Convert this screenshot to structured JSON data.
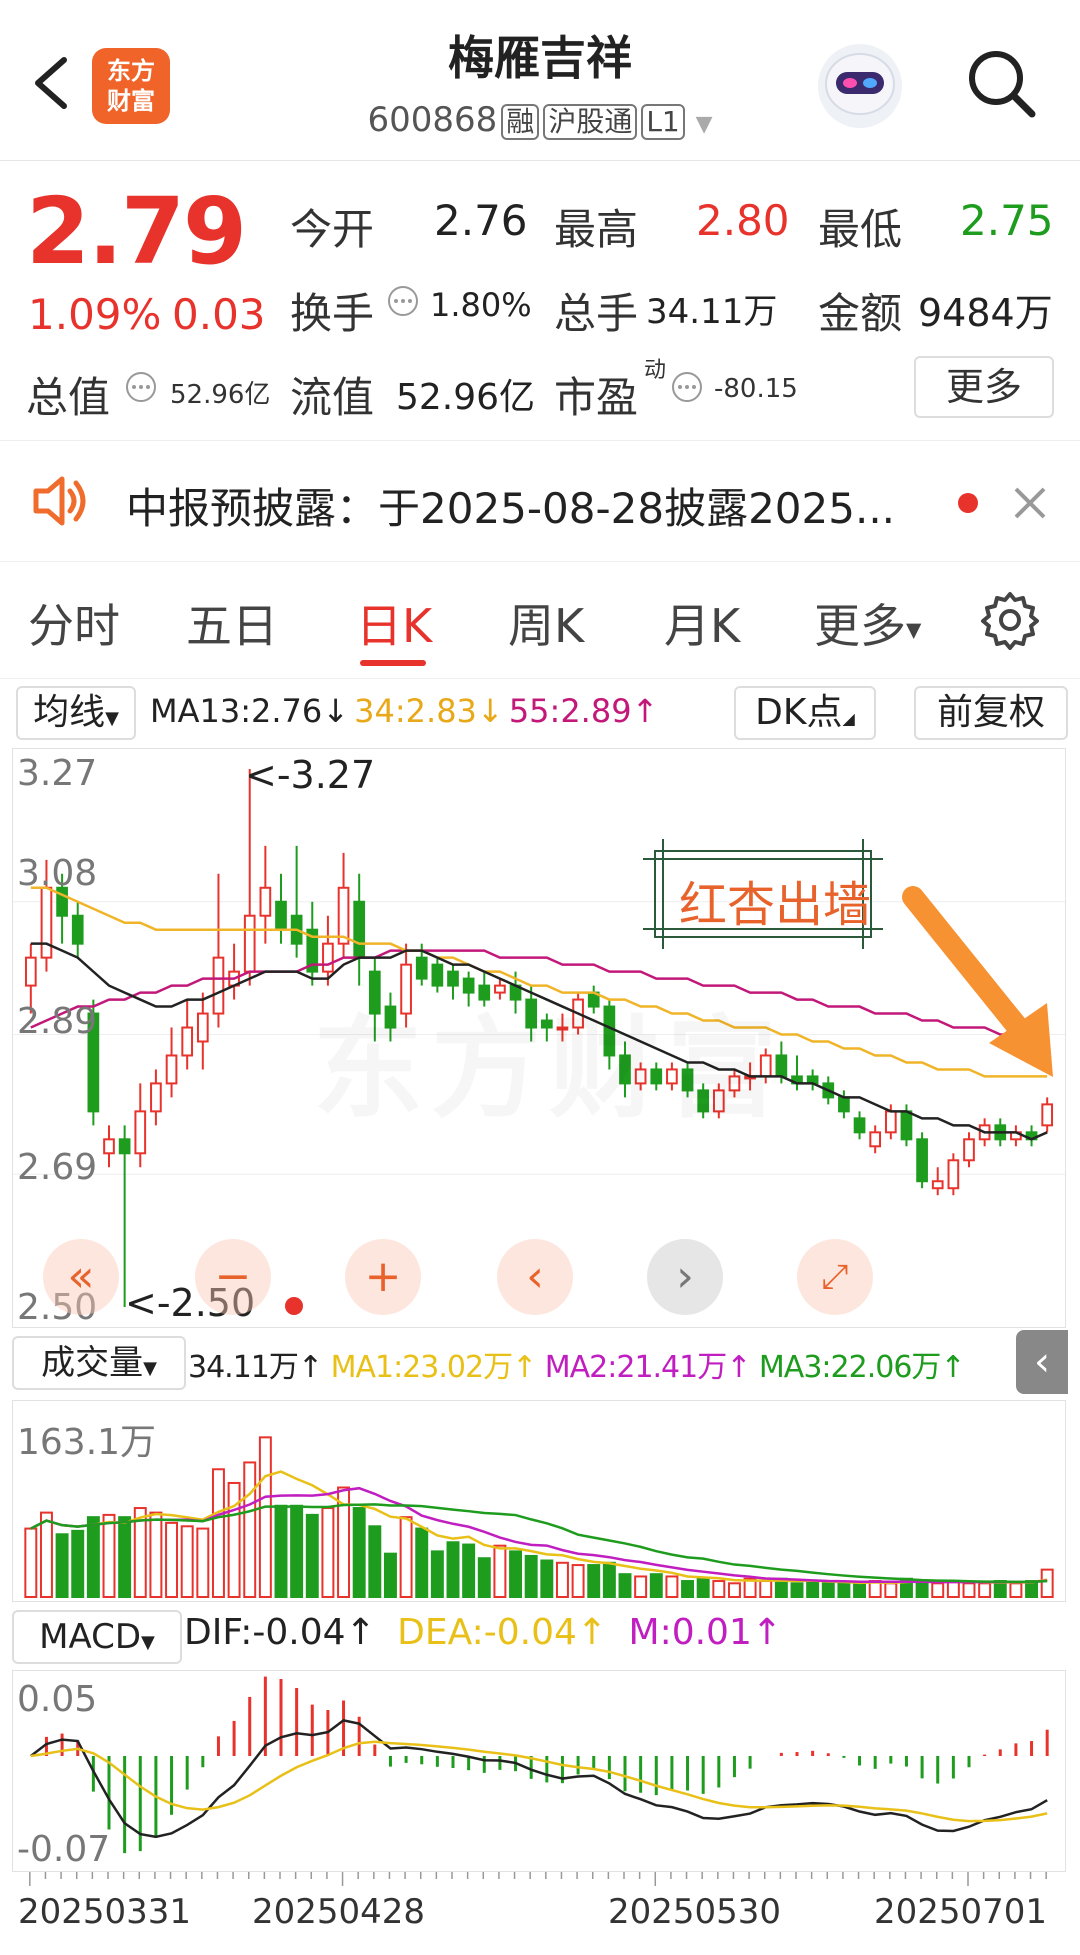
{
  "header": {
    "back_label": "<",
    "logo_text_line1": "东方",
    "logo_text_line2": "财富",
    "stock_name": "梅雁吉祥",
    "stock_code": "600868",
    "tags": [
      "融",
      "沪股通",
      "L1"
    ]
  },
  "quote": {
    "price": "2.79",
    "change_pct": "1.09%",
    "change_abs": "0.03",
    "open_label": "今开",
    "open": "2.76",
    "high_label": "最高",
    "high": "2.80",
    "low_label": "最低",
    "low": "2.75",
    "turnover_label": "换手",
    "turnover": "1.80%",
    "volume_label": "总手",
    "volume": "34.11万",
    "amount_label": "金额",
    "amount": "9484万",
    "total_cap_label": "总值",
    "total_cap": "52.96亿",
    "float_cap_label": "流值",
    "float_cap": "52.96亿",
    "pe_label": "市盈",
    "pe_sup": "动",
    "pe": "-80.15",
    "more_label": "更多"
  },
  "notice": {
    "text": "中报预披露：于2025-08-28披露2025..."
  },
  "tabs": [
    {
      "label": "分时"
    },
    {
      "label": "五日"
    },
    {
      "label": "日K"
    },
    {
      "label": "周K"
    },
    {
      "label": "月K"
    },
    {
      "label": "更多"
    }
  ],
  "kchart": {
    "ma_select": "均线",
    "ma13": "MA13:2.76↓",
    "ma34": "34:2.83↓",
    "ma55": "55:2.89↑",
    "dk_label": "DK点",
    "fq_label": "前复权",
    "y_labels": [
      "3.27",
      "3.08",
      "2.89",
      "2.69",
      "2.50"
    ],
    "max_marker": "<-3.27",
    "min_marker": "<-2.50",
    "annotation": "红杏出墙",
    "watermark": "东方财富",
    "colors": {
      "up": "#e8322c",
      "down": "#1e9c1e",
      "ma13": "#222222",
      "ma34": "#f0b429",
      "ma55": "#c2187a",
      "arrow": "#f79232"
    }
  },
  "volume": {
    "select": "成交量",
    "value": "34.11万↑",
    "ma1": "MA1:23.02万↑",
    "ma2": "MA2:21.41万↑",
    "ma3": "MA3:22.06万↑",
    "max_label": "163.1万"
  },
  "macd": {
    "select": "MACD",
    "dif": "DIF:-0.04↑",
    "dea": "DEA:-0.04↑",
    "m": "M:0.01↑",
    "top_label": "0.05",
    "bottom_label": "-0.07"
  },
  "dates": [
    "20250331",
    "20250428",
    "20250530",
    "20250701"
  ],
  "chart_data": {
    "type": "candlestick",
    "candles": [
      {
        "o": 2.96,
        "c": 3.0,
        "h": 3.02,
        "l": 2.92
      },
      {
        "o": 3.0,
        "c": 3.1,
        "h": 3.14,
        "l": 2.98
      },
      {
        "o": 3.1,
        "c": 3.06,
        "h": 3.12,
        "l": 3.02
      },
      {
        "o": 3.06,
        "c": 3.02,
        "h": 3.08,
        "l": 3.0
      },
      {
        "o": 2.92,
        "c": 2.78,
        "h": 2.94,
        "l": 2.76
      },
      {
        "o": 2.72,
        "c": 2.74,
        "h": 2.76,
        "l": 2.7
      },
      {
        "o": 2.74,
        "c": 2.72,
        "h": 2.76,
        "l": 2.5
      },
      {
        "o": 2.72,
        "c": 2.78,
        "h": 2.82,
        "l": 2.7
      },
      {
        "o": 2.78,
        "c": 2.82,
        "h": 2.84,
        "l": 2.76
      },
      {
        "o": 2.82,
        "c": 2.86,
        "h": 2.9,
        "l": 2.8
      },
      {
        "o": 2.86,
        "c": 2.9,
        "h": 2.94,
        "l": 2.84
      },
      {
        "o": 2.88,
        "c": 2.92,
        "h": 2.95,
        "l": 2.84
      },
      {
        "o": 2.92,
        "c": 3.0,
        "h": 3.12,
        "l": 2.9
      },
      {
        "o": 2.96,
        "c": 2.98,
        "h": 3.02,
        "l": 2.94
      },
      {
        "o": 2.98,
        "c": 3.06,
        "h": 3.27,
        "l": 2.96
      },
      {
        "o": 3.06,
        "c": 3.1,
        "h": 3.16,
        "l": 3.02
      },
      {
        "o": 3.08,
        "c": 3.04,
        "h": 3.12,
        "l": 3.02
      },
      {
        "o": 3.06,
        "c": 3.02,
        "h": 3.16,
        "l": 3.0
      },
      {
        "o": 3.04,
        "c": 2.98,
        "h": 3.08,
        "l": 2.96
      },
      {
        "o": 2.98,
        "c": 3.02,
        "h": 3.06,
        "l": 2.96
      },
      {
        "o": 3.02,
        "c": 3.1,
        "h": 3.15,
        "l": 3.0
      },
      {
        "o": 3.08,
        "c": 3.0,
        "h": 3.12,
        "l": 2.96
      },
      {
        "o": 2.98,
        "c": 2.92,
        "h": 3.0,
        "l": 2.88
      },
      {
        "o": 2.93,
        "c": 2.9,
        "h": 2.95,
        "l": 2.88
      },
      {
        "o": 2.92,
        "c": 2.99,
        "h": 3.02,
        "l": 2.9
      },
      {
        "o": 3.0,
        "c": 2.97,
        "h": 3.02,
        "l": 2.96
      },
      {
        "o": 2.99,
        "c": 2.96,
        "h": 3.0,
        "l": 2.95
      },
      {
        "o": 2.98,
        "c": 2.96,
        "h": 2.99,
        "l": 2.94
      },
      {
        "o": 2.97,
        "c": 2.95,
        "h": 2.98,
        "l": 2.93
      },
      {
        "o": 2.96,
        "c": 2.94,
        "h": 2.98,
        "l": 2.93
      },
      {
        "o": 2.95,
        "c": 2.96,
        "h": 2.97,
        "l": 2.94
      },
      {
        "o": 2.96,
        "c": 2.94,
        "h": 2.98,
        "l": 2.92
      },
      {
        "o": 2.94,
        "c": 2.9,
        "h": 2.96,
        "l": 2.88
      },
      {
        "o": 2.91,
        "c": 2.9,
        "h": 2.92,
        "l": 2.88
      },
      {
        "o": 2.9,
        "c": 2.9,
        "h": 2.92,
        "l": 2.88
      },
      {
        "o": 2.9,
        "c": 2.94,
        "h": 2.95,
        "l": 2.89
      },
      {
        "o": 2.95,
        "c": 2.93,
        "h": 2.96,
        "l": 2.92
      },
      {
        "o": 2.93,
        "c": 2.86,
        "h": 2.94,
        "l": 2.84
      },
      {
        "o": 2.86,
        "c": 2.82,
        "h": 2.88,
        "l": 2.8
      },
      {
        "o": 2.82,
        "c": 2.84,
        "h": 2.85,
        "l": 2.81
      },
      {
        "o": 2.84,
        "c": 2.82,
        "h": 2.85,
        "l": 2.81
      },
      {
        "o": 2.82,
        "c": 2.84,
        "h": 2.85,
        "l": 2.81
      },
      {
        "o": 2.84,
        "c": 2.81,
        "h": 2.85,
        "l": 2.8
      },
      {
        "o": 2.81,
        "c": 2.78,
        "h": 2.82,
        "l": 2.77
      },
      {
        "o": 2.78,
        "c": 2.81,
        "h": 2.82,
        "l": 2.77
      },
      {
        "o": 2.81,
        "c": 2.83,
        "h": 2.84,
        "l": 2.8
      },
      {
        "o": 2.83,
        "c": 2.83,
        "h": 2.85,
        "l": 2.81
      },
      {
        "o": 2.83,
        "c": 2.86,
        "h": 2.87,
        "l": 2.82
      },
      {
        "o": 2.86,
        "c": 2.83,
        "h": 2.88,
        "l": 2.82
      },
      {
        "o": 2.83,
        "c": 2.82,
        "h": 2.86,
        "l": 2.81
      },
      {
        "o": 2.83,
        "c": 2.82,
        "h": 2.84,
        "l": 2.81
      },
      {
        "o": 2.82,
        "c": 2.8,
        "h": 2.83,
        "l": 2.79
      },
      {
        "o": 2.8,
        "c": 2.78,
        "h": 2.81,
        "l": 2.77
      },
      {
        "o": 2.77,
        "c": 2.75,
        "h": 2.78,
        "l": 2.74
      },
      {
        "o": 2.73,
        "c": 2.75,
        "h": 2.76,
        "l": 2.72
      },
      {
        "o": 2.75,
        "c": 2.78,
        "h": 2.79,
        "l": 2.74
      },
      {
        "o": 2.78,
        "c": 2.74,
        "h": 2.79,
        "l": 2.73
      },
      {
        "o": 2.74,
        "c": 2.68,
        "h": 2.75,
        "l": 2.67
      },
      {
        "o": 2.67,
        "c": 2.68,
        "h": 2.7,
        "l": 2.66
      },
      {
        "o": 2.67,
        "c": 2.71,
        "h": 2.72,
        "l": 2.66
      },
      {
        "o": 2.71,
        "c": 2.74,
        "h": 2.75,
        "l": 2.7
      },
      {
        "o": 2.74,
        "c": 2.76,
        "h": 2.77,
        "l": 2.73
      },
      {
        "o": 2.76,
        "c": 2.74,
        "h": 2.77,
        "l": 2.73
      },
      {
        "o": 2.74,
        "c": 2.75,
        "h": 2.76,
        "l": 2.73
      },
      {
        "o": 2.75,
        "c": 2.74,
        "h": 2.76,
        "l": 2.73
      },
      {
        "o": 2.76,
        "c": 2.79,
        "h": 2.8,
        "l": 2.75
      }
    ],
    "ma13": [
      3.02,
      3.02,
      3.01,
      3.0,
      2.98,
      2.96,
      2.95,
      2.94,
      2.93,
      2.93,
      2.94,
      2.94,
      2.95,
      2.96,
      2.97,
      2.98,
      2.98,
      2.98,
      2.97,
      2.97,
      2.99,
      3.0,
      3.0,
      3.0,
      3.01,
      3.01,
      3.0,
      2.99,
      2.99,
      2.98,
      2.97,
      2.96,
      2.95,
      2.94,
      2.93,
      2.92,
      2.91,
      2.9,
      2.89,
      2.88,
      2.87,
      2.86,
      2.85,
      2.85,
      2.84,
      2.84,
      2.83,
      2.83,
      2.83,
      2.82,
      2.82,
      2.81,
      2.8,
      2.8,
      2.79,
      2.78,
      2.78,
      2.77,
      2.77,
      2.76,
      2.76,
      2.75,
      2.75,
      2.75,
      2.74,
      2.75
    ],
    "ma34": [
      3.1,
      3.1,
      3.09,
      3.08,
      3.07,
      3.06,
      3.05,
      3.05,
      3.04,
      3.04,
      3.04,
      3.04,
      3.04,
      3.04,
      3.04,
      3.04,
      3.04,
      3.04,
      3.03,
      3.03,
      3.03,
      3.02,
      3.02,
      3.02,
      3.01,
      3.01,
      3.0,
      3.0,
      2.99,
      2.98,
      2.98,
      2.97,
      2.96,
      2.96,
      2.95,
      2.95,
      2.95,
      2.94,
      2.94,
      2.93,
      2.93,
      2.92,
      2.92,
      2.91,
      2.91,
      2.9,
      2.9,
      2.9,
      2.89,
      2.89,
      2.88,
      2.88,
      2.87,
      2.87,
      2.86,
      2.86,
      2.85,
      2.85,
      2.84,
      2.84,
      2.84,
      2.83,
      2.83,
      2.83,
      2.83,
      2.83
    ],
    "ma55": [
      2.9,
      2.91,
      2.92,
      2.93,
      2.93,
      2.94,
      2.94,
      2.95,
      2.95,
      2.96,
      2.96,
      2.97,
      2.97,
      2.97,
      2.98,
      2.98,
      2.98,
      2.98,
      2.99,
      2.99,
      3.0,
      3.0,
      3.0,
      3.01,
      3.01,
      3.01,
      3.01,
      3.01,
      3.01,
      3.01,
      3.0,
      3.0,
      3.0,
      3.0,
      2.99,
      2.99,
      2.99,
      2.98,
      2.98,
      2.98,
      2.97,
      2.97,
      2.97,
      2.96,
      2.96,
      2.96,
      2.95,
      2.95,
      2.95,
      2.94,
      2.94,
      2.93,
      2.93,
      2.93,
      2.92,
      2.92,
      2.92,
      2.91,
      2.91,
      2.9,
      2.9,
      2.9,
      2.89,
      2.89,
      2.89,
      2.89
    ],
    "volumes": [
      60,
      74,
      55,
      58,
      70,
      72,
      70,
      78,
      74,
      65,
      62,
      60,
      112,
      100,
      118,
      140,
      80,
      80,
      72,
      78,
      96,
      78,
      62,
      38,
      70,
      60,
      40,
      48,
      46,
      34,
      45,
      40,
      36,
      32,
      30,
      28,
      28,
      30,
      20,
      18,
      20,
      18,
      14,
      16,
      14,
      12,
      16,
      14,
      16,
      12,
      14,
      12,
      12,
      12,
      14,
      12,
      16,
      14,
      12,
      14,
      12,
      12,
      14,
      12,
      14,
      24
    ],
    "y_range": [
      2.5,
      3.27
    ],
    "volume_max": 163.1,
    "macd_range": [
      -0.07,
      0.05
    ]
  }
}
